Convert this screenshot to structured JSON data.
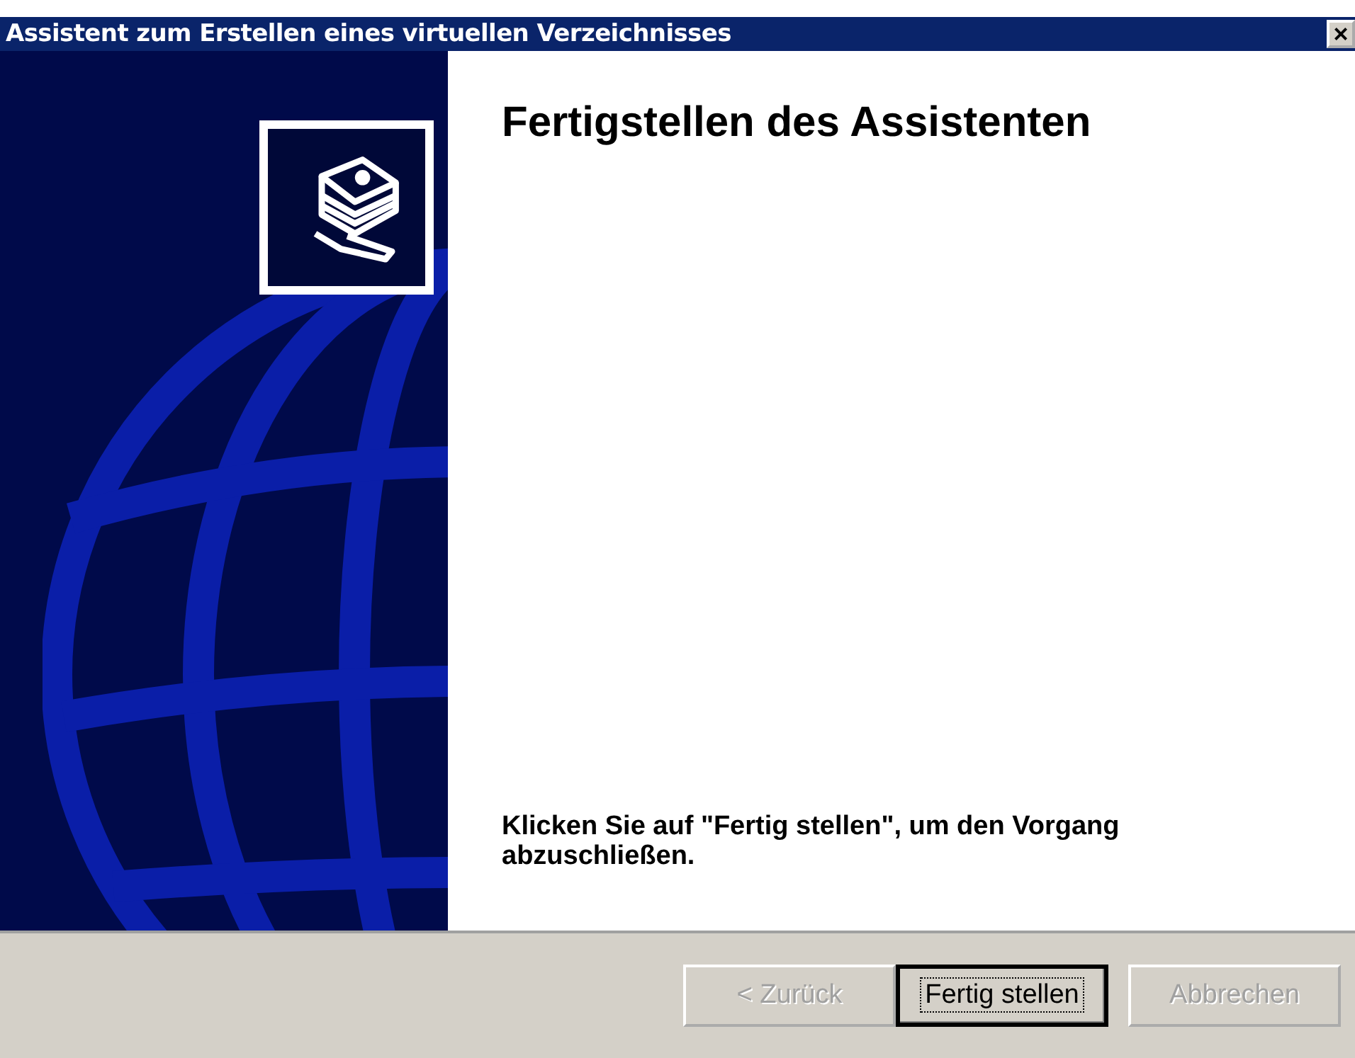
{
  "window": {
    "title": "Assistent zum Erstellen eines virtuellen Verzeichnisses",
    "close_symbol": "×"
  },
  "heading": "Fertigstellen des Assistenten",
  "instruction": "Klicken Sie auf \"Fertig stellen\", um den Vorgang abzuschließen.",
  "buttons": [
    {
      "label": "< Zurück",
      "disabled": true,
      "default": false
    },
    {
      "label": "Fertig stellen",
      "disabled": false,
      "default": true
    },
    {
      "label": "Abbrechen",
      "disabled": true,
      "default": false
    }
  ]
}
